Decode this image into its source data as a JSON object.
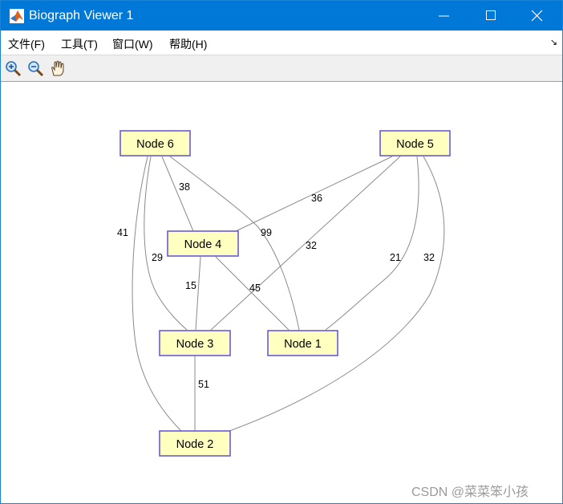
{
  "window": {
    "title": "Biograph Viewer 1"
  },
  "menu": {
    "items": [
      "文件(F)",
      "工具(T)",
      "窗口(W)",
      "帮助(H)"
    ]
  },
  "toolbar": {
    "tools": [
      "zoom-in-icon",
      "zoom-out-icon",
      "pan-hand-icon"
    ]
  },
  "graph": {
    "nodes": [
      "Node 6",
      "Node 5",
      "Node 4",
      "Node 3",
      "Node 1",
      "Node 2"
    ],
    "edge_weights": {
      "node6_node4": "38",
      "node6_node2": "41",
      "node6_node3": "29",
      "node6_node1": "99",
      "node5_node4": "36",
      "node5_node3": "32",
      "node5_node1": "21",
      "node5_node2": "32",
      "node4_node3": "15",
      "node4_node1": "45",
      "node3_node2": "51"
    },
    "colors": {
      "node_fill": "#ffffc0",
      "node_border": "#6a5ad6",
      "edge": "#8a8a8a"
    }
  },
  "watermark": "CSDN @菜菜笨小孩"
}
